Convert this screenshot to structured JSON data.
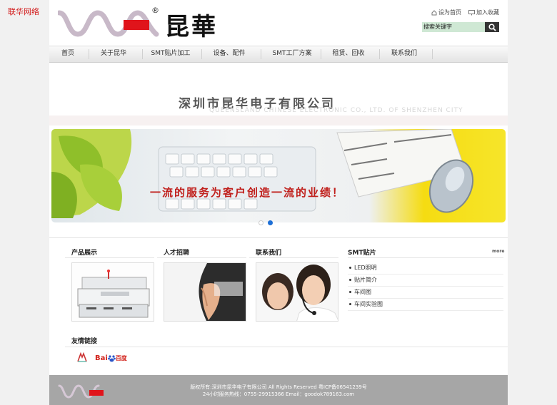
{
  "corner_link": "联华网络",
  "header": {
    "logo_text": "昆華",
    "registered_mark": "®",
    "top_links": [
      "设为首页",
      "加入收藏"
    ],
    "search_placeholder": "搜索关键字"
  },
  "nav": [
    "首页",
    "关于昆华",
    "SMT贴片加工",
    "设备、配件",
    "SMT工厂方案",
    "租赁、回收",
    "联系我们"
  ],
  "banner": {
    "company_name": "深圳市昆华电子有限公司",
    "company_name_en": "QUEENSLAND CHINESE ELECTRONIC CO., LTD. OF SHENZHEN CITY",
    "slogan": "一流的服务为客户创造一流的业绩！"
  },
  "sections": {
    "products": "产品展示",
    "recruit": "人才招聘",
    "contact": "联系我们",
    "smt": "SMT贴片",
    "more": "more"
  },
  "smt_items": [
    "LED照明",
    "贴片简介",
    "车间图",
    "车间实验图"
  ],
  "friend_links": {
    "title": "友情链接",
    "baidu_a": "Bai",
    "baidu_b": "百度"
  },
  "footer": {
    "line1": "版权所有:深圳市昆华电子有限公司 All Rights Reserved 粤ICP备06541239号",
    "line2": "24小时服务热线：0755-29915366 Email：goodok789163.com"
  },
  "colors": {
    "brand_red": "#e0141b",
    "nav_bg": "#e8e8e8",
    "footer_bg": "#a6a6a6",
    "search_bg": "#cfe8d4",
    "active_dot": "#1d6fd6"
  }
}
